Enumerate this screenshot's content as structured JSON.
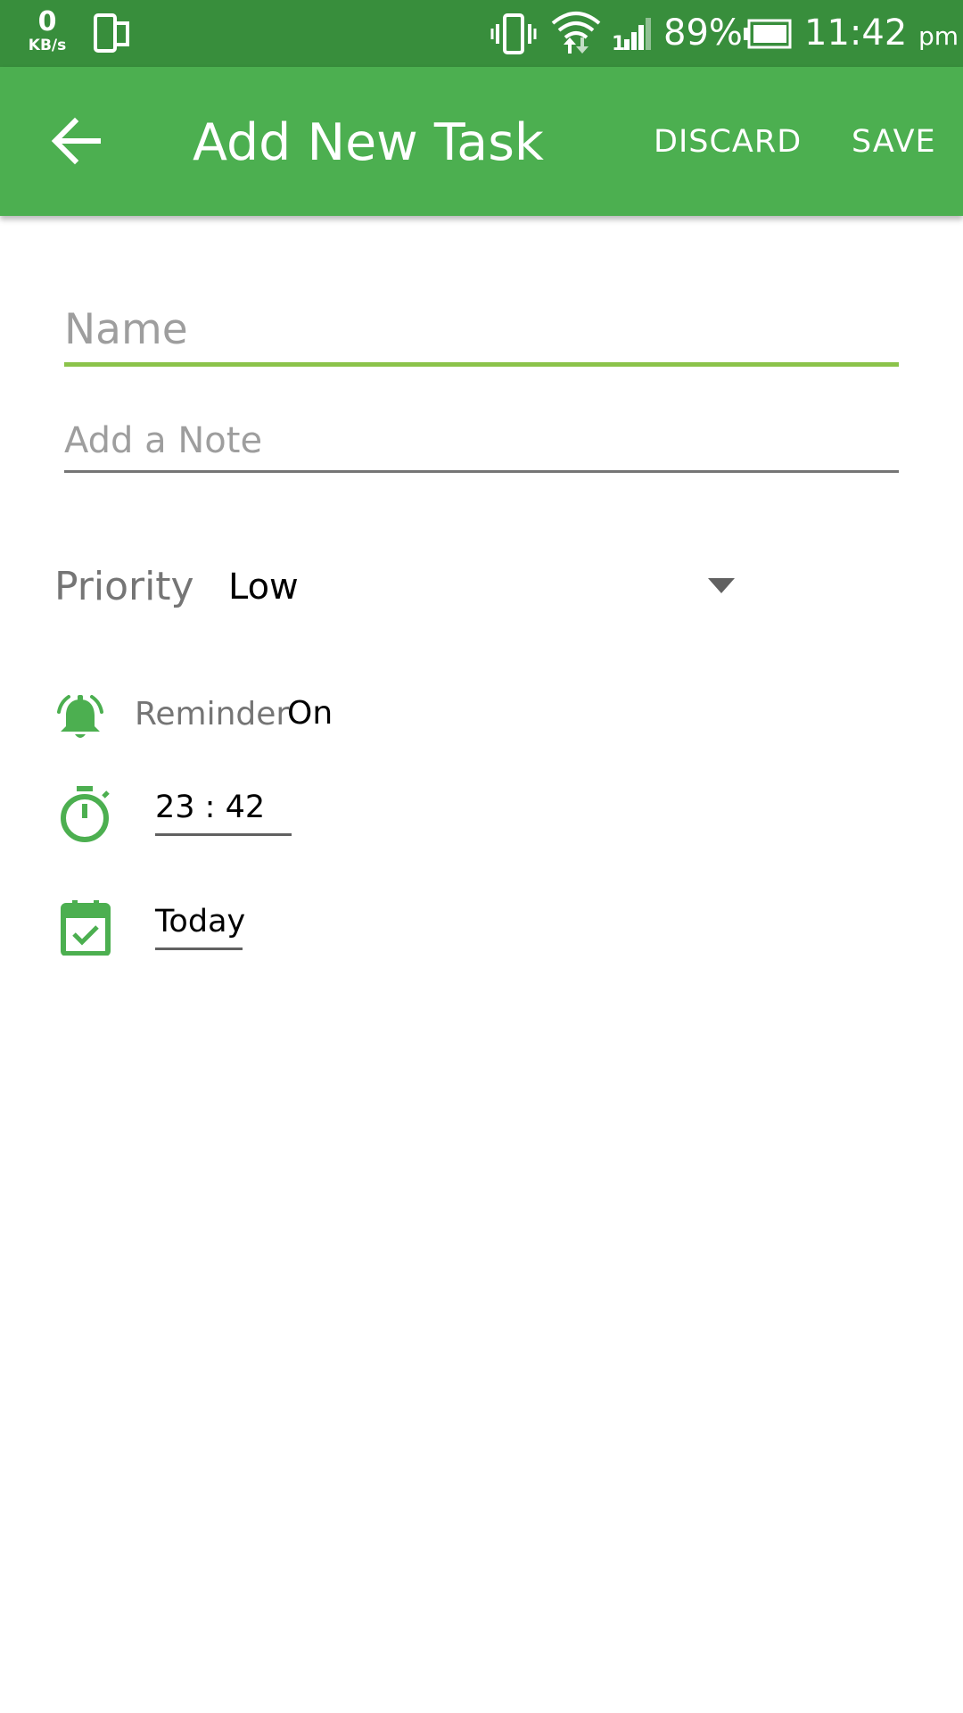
{
  "status_bar": {
    "net_speed_value": "0",
    "net_speed_unit": "KB/s",
    "battery_percent": "89%",
    "time": "11:42",
    "time_suffix": "pm"
  },
  "app_bar": {
    "title": "Add New Task",
    "discard_label": "DISCARD",
    "save_label": "SAVE",
    "back_icon": "arrow-back-icon",
    "background_color": "#4caf50",
    "status_bar_color": "#388e3c"
  },
  "form": {
    "name_placeholder": "Name",
    "name_value": "",
    "note_placeholder": "Add a Note",
    "note_value": "",
    "accent_color": "#8bc34a",
    "priority": {
      "label": "Priority",
      "selected": "Low"
    },
    "reminder": {
      "icon": "alarm-bell-icon",
      "label": "Reminder",
      "value": "On"
    },
    "time": {
      "icon": "stopwatch-icon",
      "value": "23 : 42"
    },
    "date": {
      "icon": "calendar-check-icon",
      "value": "Today"
    },
    "icon_color": "#4caf50"
  }
}
